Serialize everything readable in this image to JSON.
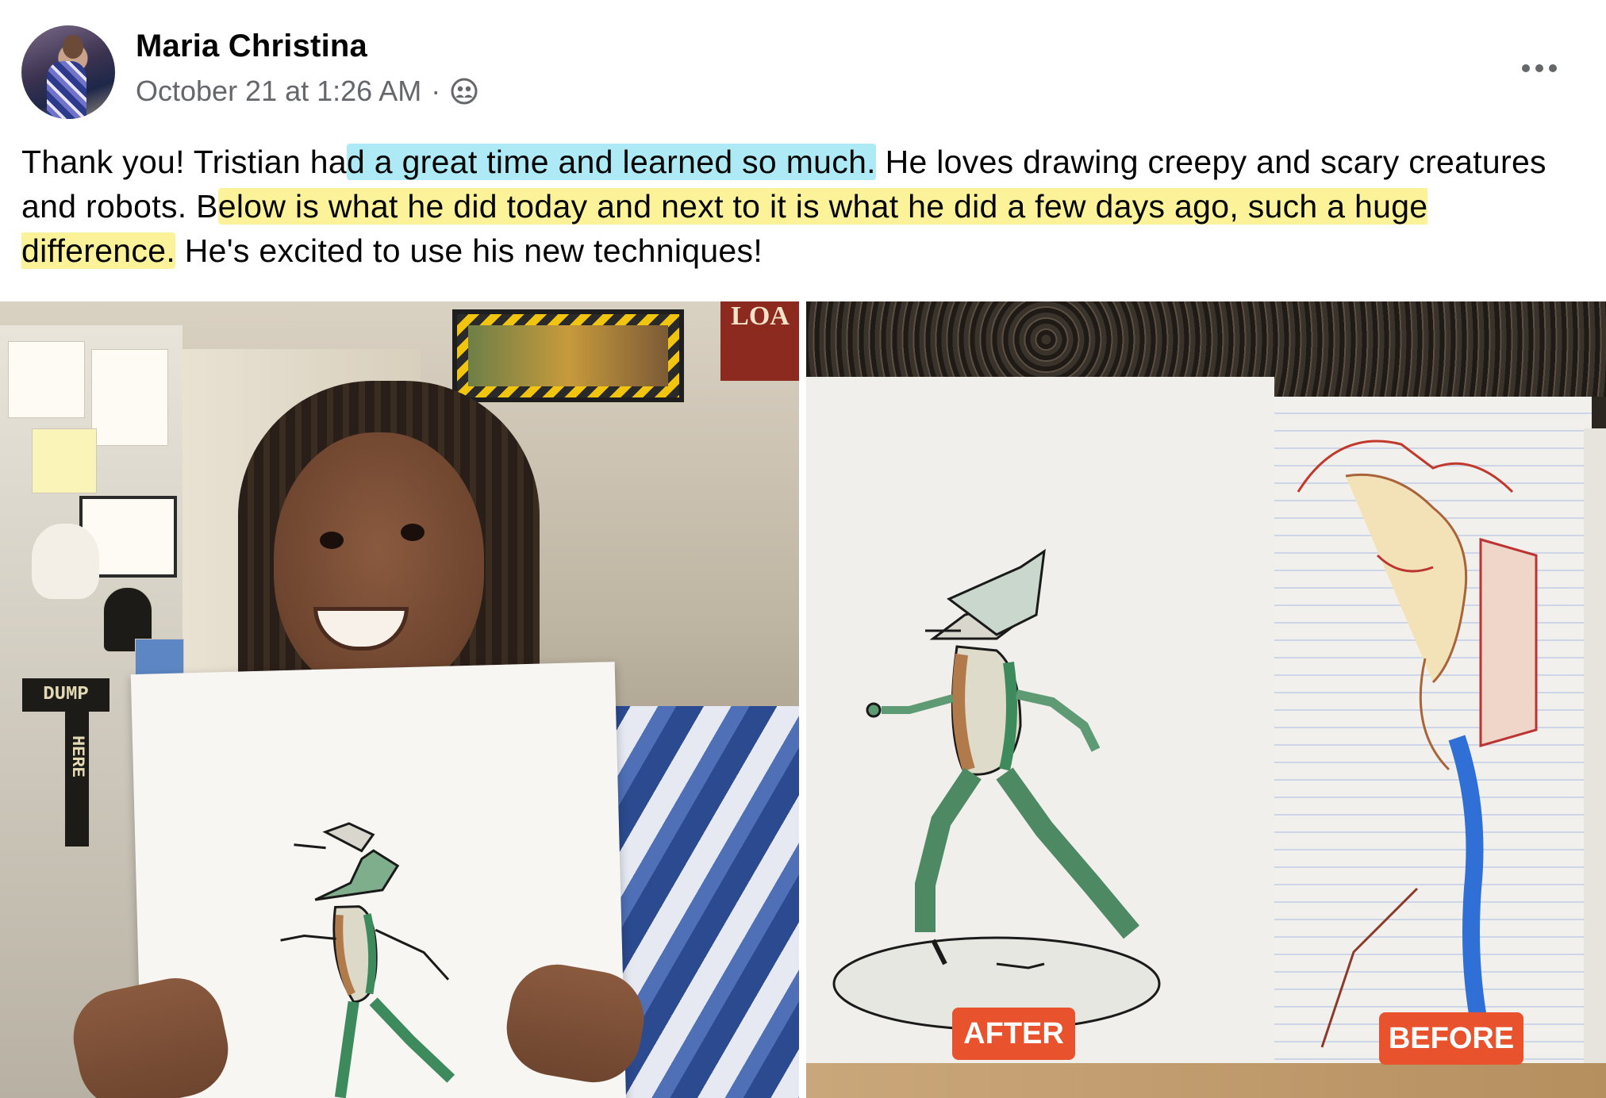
{
  "post": {
    "author": "Maria Christina",
    "timestamp": "October 21 at 1:26 AM",
    "separator": "·",
    "audience_icon": "friends-audience-icon",
    "more_icon": "more-options-icon",
    "text": {
      "part1": "Thank you! Tristian ha",
      "highlight_blue": "d a great time and learned so much.",
      "part2": " He loves drawing creepy and scary creatures and robots. B",
      "highlight_yellow": "elow is what he did today and next to it is what he did a few days ago, such a huge difference.",
      "part3": " He's excited to use his new techniques!"
    }
  },
  "photos": {
    "left_sign_top": "LOA",
    "left_dump_sign": "DUMP",
    "left_here_sign": "HERE",
    "label_after": "AFTER",
    "label_before": "BEFORE"
  },
  "colors": {
    "author": "#050505",
    "meta": "#65676b",
    "highlight_blue": "#aeeaf5",
    "highlight_yellow": "#fbf29a",
    "label_bg": "#e8522d"
  }
}
